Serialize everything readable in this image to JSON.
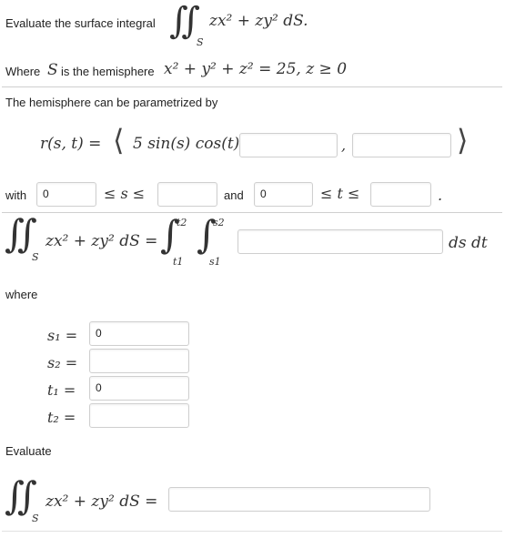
{
  "prompt": {
    "evaluate_label": "Evaluate the surface integral",
    "integrand": "zx² + zy² dS.",
    "surface_sym": "S",
    "where_label": "Where",
    "is_label": "is the hemisphere",
    "hemisphere_eq": "x² + y² + z² = 25,  z ≥ 0",
    "param_label": "The hemisphere can be parametrized by"
  },
  "param": {
    "r_lhs": "r(s, t) =",
    "first_component": "5 sin(s) cos(t) ,",
    "comp2_value": "",
    "comma": ",",
    "comp3_value": ""
  },
  "bounds": {
    "with_label": "with",
    "s_lower": "0",
    "s_ineq": "≤ s ≤",
    "s_upper": "",
    "and_label": "and",
    "t_lower": "0",
    "t_ineq": "≤ t ≤",
    "t_upper": "",
    "period": "."
  },
  "iterated": {
    "lhs": "zx² + zy² dS =",
    "upper_outer": "t2",
    "lower_outer": "t1",
    "upper_inner": "s2",
    "lower_inner": "s1",
    "integrand_value": "",
    "ds_dt": "ds dt"
  },
  "limits": {
    "where_label": "where",
    "rows": [
      {
        "label": "s₁ =",
        "value": "0"
      },
      {
        "label": "s₂ =",
        "value": ""
      },
      {
        "label": "t₁ =",
        "value": "0"
      },
      {
        "label": "t₂ =",
        "value": ""
      }
    ]
  },
  "final": {
    "evaluate_label": "Evaluate",
    "lhs": "zx² + zy² dS =",
    "answer_value": ""
  }
}
